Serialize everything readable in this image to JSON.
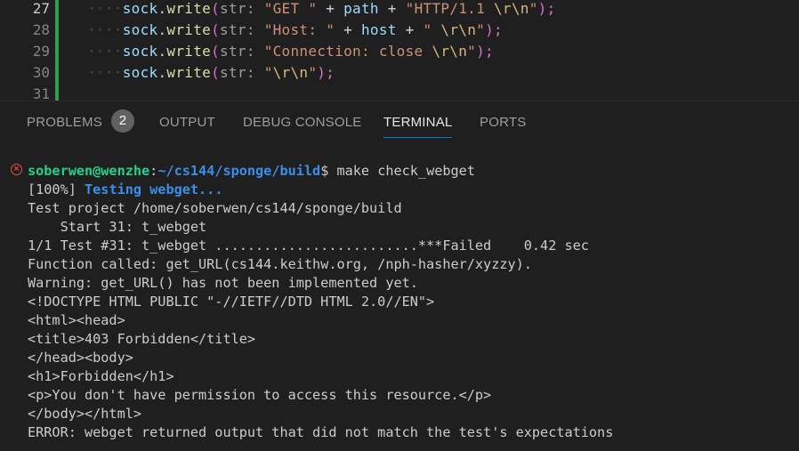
{
  "editor": {
    "lines": [
      {
        "num": "27",
        "indent": "····",
        "obj": "sock",
        "dot": ".",
        "method": "write",
        "open": "(",
        "hint": "str:",
        "parts": [
          {
            "t": "\"GET \"",
            "c": "str"
          },
          {
            "t": " + ",
            "c": "op"
          },
          {
            "t": "path",
            "c": "var"
          },
          {
            "t": " + ",
            "c": "op"
          },
          {
            "t": "\"HTTP/1.1 ",
            "c": "str"
          },
          {
            "t": "\\r\\n",
            "c": "esc"
          },
          {
            "t": "\"",
            "c": "str"
          }
        ],
        "close": ");"
      },
      {
        "num": "28",
        "indent": "····",
        "obj": "sock",
        "dot": ".",
        "method": "write",
        "open": "(",
        "hint": "str:",
        "parts": [
          {
            "t": "\"Host: \"",
            "c": "str"
          },
          {
            "t": " + ",
            "c": "op"
          },
          {
            "t": "host",
            "c": "var"
          },
          {
            "t": " + ",
            "c": "op"
          },
          {
            "t": "\" ",
            "c": "str"
          },
          {
            "t": "\\r\\n",
            "c": "esc"
          },
          {
            "t": "\"",
            "c": "str"
          }
        ],
        "close": ");"
      },
      {
        "num": "29",
        "indent": "····",
        "obj": "sock",
        "dot": ".",
        "method": "write",
        "open": "(",
        "hint": "str:",
        "parts": [
          {
            "t": "\"Connection: close ",
            "c": "str"
          },
          {
            "t": "\\r\\n",
            "c": "esc"
          },
          {
            "t": "\"",
            "c": "str"
          }
        ],
        "close": ");"
      },
      {
        "num": "30",
        "indent": "····",
        "obj": "sock",
        "dot": ".",
        "method": "write",
        "open": "(",
        "hint": "str:",
        "parts": [
          {
            "t": "\"",
            "c": "str"
          },
          {
            "t": "\\r\\n",
            "c": "esc"
          },
          {
            "t": "\"",
            "c": "str"
          }
        ],
        "close": ");"
      },
      {
        "num": "31",
        "indent": "",
        "obj": "",
        "dot": "",
        "method": "",
        "open": "",
        "hint": "",
        "parts": [],
        "close": ""
      }
    ]
  },
  "panel": {
    "tabs": [
      {
        "label": "PROBLEMS",
        "badge": "2"
      },
      {
        "label": "OUTPUT"
      },
      {
        "label": "DEBUG CONSOLE"
      },
      {
        "label": "TERMINAL"
      },
      {
        "label": "PORTS"
      }
    ],
    "active_tab": "TERMINAL"
  },
  "terminal": {
    "prompt_user": "soberwen@wenzhe",
    "prompt_sep": ":",
    "prompt_path": "~/cs144/sponge/build",
    "prompt_symbol": "$ ",
    "command": "make check_webget",
    "progress_prefix": "[100%] ",
    "progress_text": "Testing webget...",
    "output": [
      "Test project /home/soberwen/cs144/sponge/build",
      "    Start 31: t_webget",
      "1/1 Test #31: t_webget .........................***Failed    0.42 sec",
      "Function called: get_URL(cs144.keithw.org, /nph-hasher/xyzzy).",
      "Warning: get_URL() has not been implemented yet.",
      "<!DOCTYPE HTML PUBLIC \"-//IETF//DTD HTML 2.0//EN\">",
      "<html><head>",
      "<title>403 Forbidden</title>",
      "</head><body>",
      "<h1>Forbidden</h1>",
      "<p>You don't have permission to access this resource.</p>",
      "</body></html>",
      "ERROR: webget returned output that did not match the test's expectations"
    ],
    "error_icon": "error-circle-icon"
  }
}
